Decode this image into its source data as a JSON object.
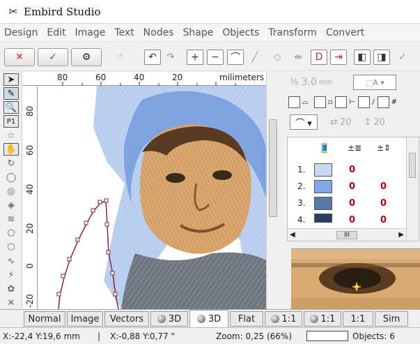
{
  "window": {
    "title": "Embird Studio",
    "icon": "needle-icon"
  },
  "menu": [
    "Design",
    "Edit",
    "Image",
    "Text",
    "Nodes",
    "Shape",
    "Objects",
    "Transform",
    "Convert"
  ],
  "toolbar": {
    "cancel_symbol": "✕",
    "ok_symbol": "✓",
    "cancel_color": "#d42020",
    "ok_color": "#2a8a2a"
  },
  "ruler": {
    "units": "milimeters",
    "top_ticks": [
      "80",
      "60",
      "40",
      "20"
    ],
    "left_ticks": [
      "80",
      "60",
      "40",
      "20",
      "0",
      "-20"
    ]
  },
  "right_panel": {
    "stitch_length": "3.0",
    "stitch_length_unit": "mm",
    "angle_a": "20",
    "angle_b": "20",
    "colors": [
      {
        "index": "1.",
        "color": "#c8d8f0",
        "v1": "0",
        "v2": ""
      },
      {
        "index": "2.",
        "color": "#7fa8e8",
        "v1": "0",
        "v2": "0"
      },
      {
        "index": "3.",
        "color": "#5a78a8",
        "v1": "0",
        "v2": "0"
      },
      {
        "index": "4.",
        "color": "#2c3e5e",
        "v1": "0",
        "v2": "0"
      }
    ],
    "hscroll_label": "III"
  },
  "tabs": [
    {
      "label": "Normal"
    },
    {
      "label": "Image"
    },
    {
      "label": "Vectors"
    },
    {
      "label": "3D"
    },
    {
      "label": "3D",
      "active": true
    },
    {
      "label": "Flat"
    },
    {
      "label": "1:1"
    },
    {
      "label": "1:1"
    },
    {
      "label": "1:1"
    },
    {
      "label": "Sim"
    }
  ],
  "status": {
    "cursor": "X:-22,4  Y:19,6 mm",
    "separator": "|",
    "offset": "X:-0,88  Y:0,77 \"",
    "zoom": "Zoom: 0,25 (66%)",
    "objects": "Objects: 6"
  }
}
